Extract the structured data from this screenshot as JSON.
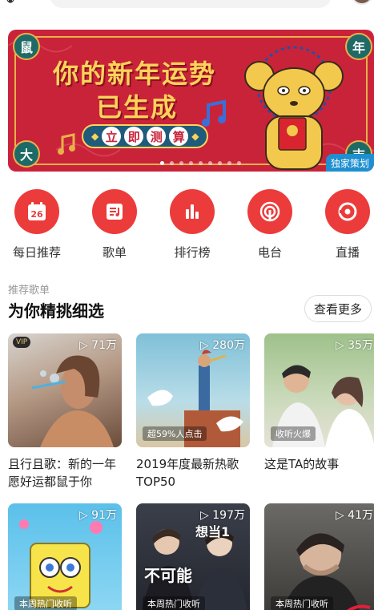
{
  "banner": {
    "title_line1": "你的新年运势",
    "title_line2": "已生成",
    "test_chars": [
      "立",
      "即",
      "测",
      "算"
    ],
    "corner_chars": [
      "鼠",
      "年",
      "大",
      "吉"
    ],
    "badge": "独家策划",
    "active_dot": 0,
    "dot_count": 9,
    "accent": "#c9233a"
  },
  "quick_entries": [
    {
      "label": "每日推荐",
      "icon": "calendar-icon",
      "badge_text": "26"
    },
    {
      "label": "歌单",
      "icon": "playlist-icon"
    },
    {
      "label": "排行榜",
      "icon": "chart-bars-icon"
    },
    {
      "label": "电台",
      "icon": "radio-icon"
    },
    {
      "label": "直播",
      "icon": "live-icon"
    }
  ],
  "section": {
    "subtitle": "推荐歌单",
    "title": "为你精挑细选",
    "more_label": "查看更多"
  },
  "playlists": [
    {
      "name": "且行且歌：新的一年愿好运都鼠于你",
      "plays": "▷ 71万",
      "tag": "",
      "vip": "VIP"
    },
    {
      "name": "2019年度最新热歌TOP50",
      "plays": "▷ 280万",
      "tag": "超59%人点击"
    },
    {
      "name": "这是TA的故事",
      "plays": "▷ 35万",
      "tag": "收听火爆"
    },
    {
      "name": "",
      "plays": "▷ 91万",
      "tag": "本周热门收听"
    },
    {
      "name": "",
      "plays": "▷ 197万",
      "tag": "本周热门收听",
      "overlay_1": "想当1",
      "overlay_2": "不可能"
    },
    {
      "name": "",
      "plays": "▷ 41万",
      "tag": "本周热门收听"
    }
  ]
}
